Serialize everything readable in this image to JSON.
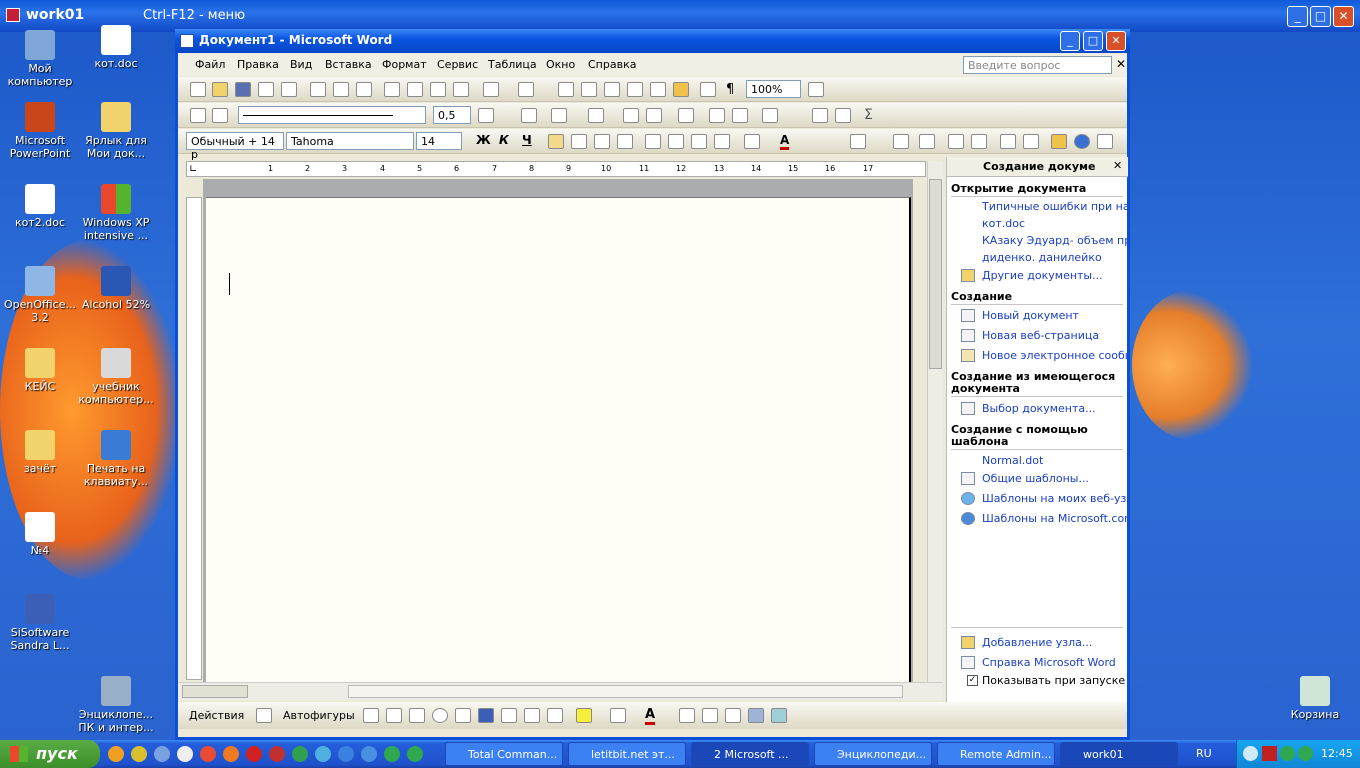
{
  "remote_bar": {
    "host": "work01",
    "hint": "Ctrl-F12 - меню"
  },
  "desktop_icons": [
    {
      "label": "Мой компьютер",
      "icon": "my-computer-icon"
    },
    {
      "label": "кот.doc",
      "icon": "word-doc-icon"
    },
    {
      "label": "Microsoft PowerPoint",
      "icon": "powerpoint-icon"
    },
    {
      "label": "Ярлык для Мои док...",
      "icon": "folder-shortcut-icon"
    },
    {
      "label": "кот2.doc",
      "icon": "word-doc-icon"
    },
    {
      "label": "Windows XP intensive ...",
      "icon": "windows-icon"
    },
    {
      "label": "OpenOffice... 3.2",
      "icon": "openoffice-icon"
    },
    {
      "label": "Alcohol 52%",
      "icon": "alcohol-icon"
    },
    {
      "label": "КЕЙС",
      "icon": "folder-icon"
    },
    {
      "label": "учебник компьютер...",
      "icon": "flash-icon"
    },
    {
      "label": "зачёт",
      "icon": "folder-icon"
    },
    {
      "label": "Печать на клавиату...",
      "icon": "cursor-app-icon"
    },
    {
      "label": "№4",
      "icon": "document-icon"
    },
    {
      "label": "SiSoftware Sandra L...",
      "icon": "sisoftware-icon"
    },
    {
      "label": "Энциклопе... ПК и интер...",
      "icon": "computer-icon"
    },
    {
      "label": "Корзина",
      "icon": "recycle-bin-icon"
    }
  ],
  "word": {
    "title": "Документ1 - Microsoft Word",
    "menu": [
      "Файл",
      "Правка",
      "Вид",
      "Вставка",
      "Формат",
      "Сервис",
      "Таблица",
      "Окно",
      "Справка"
    ],
    "ask_placeholder": "Введите вопрос",
    "zoom": "100%",
    "line_width": "0,5",
    "style": "Обычный + 14 р",
    "font": "Tahoma",
    "font_size": "14",
    "bold": "Ж",
    "italic": "К",
    "underline": "Ч",
    "ruler_numbers": [
      "1",
      "2",
      "3",
      "4",
      "5",
      "6",
      "7",
      "8",
      "9",
      "10",
      "11",
      "12",
      "13",
      "14",
      "15",
      "16",
      "17"
    ],
    "draw_actions": "Действия",
    "autoshapes": "Автофигуры"
  },
  "task_pane": {
    "title": "Создание докуме",
    "open_section": "Открытие документа",
    "recent": [
      "Типичные ошибки при набс",
      "кот.doc",
      "КАзаку Эдуард- объем прод",
      "диденко. данилейко"
    ],
    "other_docs": "Другие документы...",
    "create_section": "Создание",
    "create_items": [
      "Новый документ",
      "Новая веб-страница",
      "Новое электронное сообщен"
    ],
    "from_existing_section": "Создание из имеющегося документа",
    "choose_doc": "Выбор документа...",
    "template_section": "Создание с помощью шаблона",
    "templates": [
      "Normal.dot",
      "Общие шаблоны...",
      "Шаблоны на моих веб-узлах",
      "Шаблоны на Microsoft.com"
    ],
    "add_site": "Добавление узла...",
    "help": "Справка Microsoft Word",
    "show_at_startup": "Показывать при запуске"
  },
  "taskbar": {
    "start": "пуск",
    "buttons": [
      "Total Comman...",
      "letitbit.net эт...",
      "2 Microsoft ...",
      "Энциклопеди...",
      "Remote Admin...",
      "work01"
    ],
    "lang": "RU",
    "clock": "12:45"
  }
}
